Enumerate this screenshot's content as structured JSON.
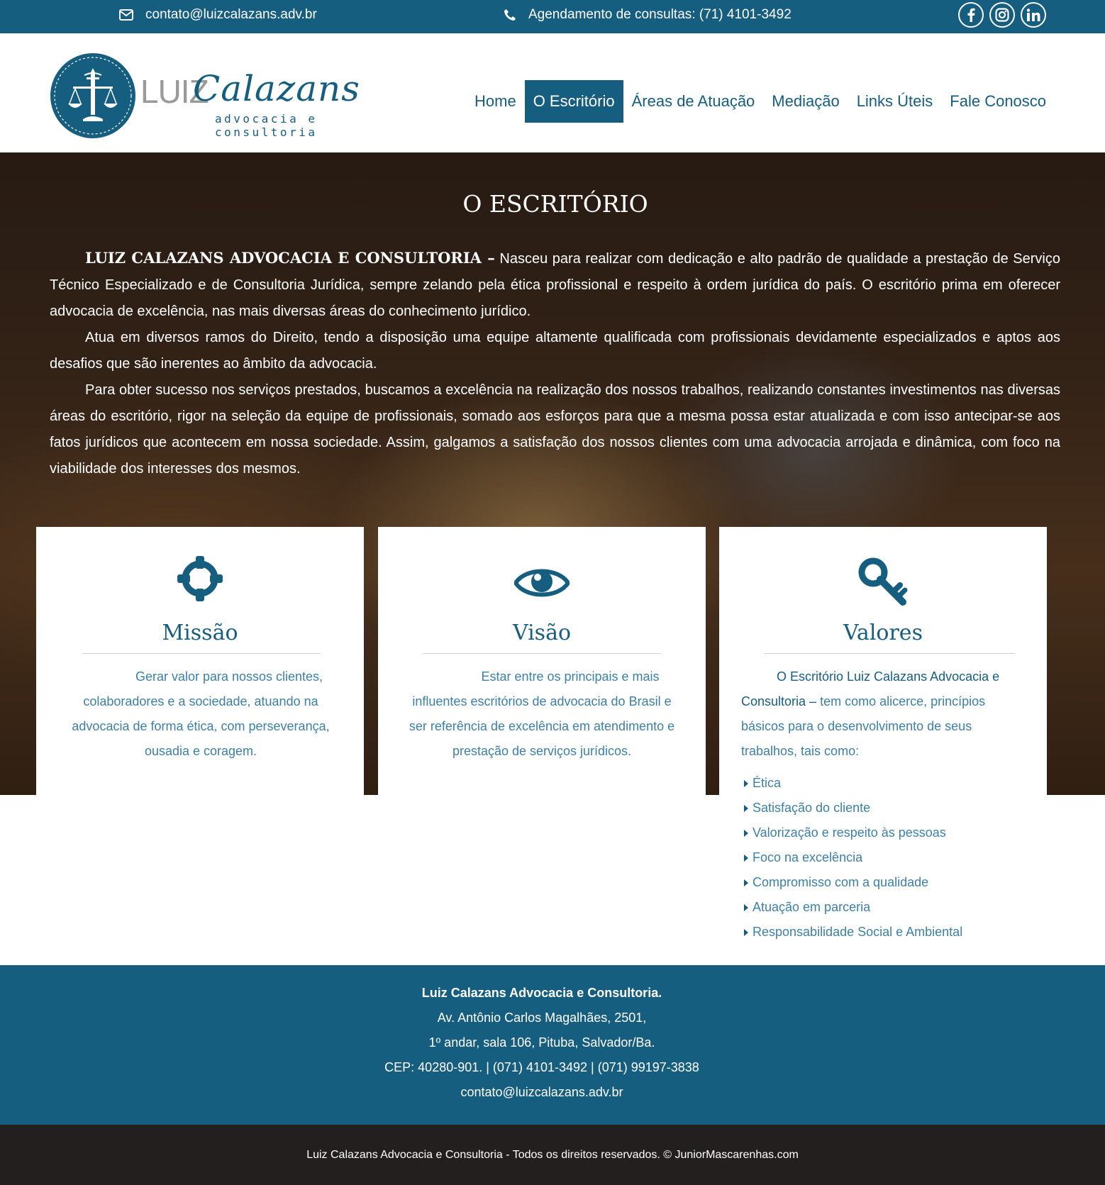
{
  "topbar": {
    "email": "contato@luizcalazans.adv.br",
    "phone": "Agendamento de consultas: (71) 4101-3492",
    "social": [
      "facebook-icon",
      "instagram-icon",
      "linkedin-icon"
    ]
  },
  "logo": {
    "word1": "LUIZ",
    "word2": "Calazans",
    "subtitle": "advocacia e consultoria"
  },
  "nav": {
    "items": [
      {
        "label": "Home"
      },
      {
        "label": "O Escritório",
        "active": true
      },
      {
        "label": "Áreas de Atuação"
      },
      {
        "label": "Mediação"
      },
      {
        "label": "Links Úteis"
      },
      {
        "label": "Fale Conosco"
      }
    ]
  },
  "hero": {
    "title": "O ESCRITÓRIO",
    "p1_strong": "LUIZ CALAZANS ADVOCACIA E CONSULTORIA –",
    "p1": " Nasceu para realizar com dedicação e alto padrão de qualidade a prestação de Serviço Técnico Especializado e de Consultoria Jurídica, sempre zelando pela ética profissional e respeito à ordem jurídica do país. O escritório prima em oferecer advocacia de excelência, nas mais diversas áreas do conhecimento jurídico.",
    "p2": "Atua em diversos ramos do Direito, tendo a disposição uma equipe altamente qualificada com profissionais devidamente especializados e aptos aos desafios que são inerentes ao âmbito da advocacia.",
    "p3": "Para obter sucesso nos serviços prestados, buscamos a excelência na realização dos nossos trabalhos, realizando constantes investimentos nas diversas áreas do escritório, rigor na seleção da equipe de profissionais, somado aos esforços para que a mesma possa estar atualizada e com isso antecipar-se aos fatos jurídicos que acontecem em nossa sociedade. Assim, galgamos a satisfação dos nossos clientes com uma advocacia arrojada e dinâmica, com foco na viabilidade dos interesses dos mesmos."
  },
  "cards": {
    "missao": {
      "icon": "crosshair-icon",
      "title": "Missão",
      "text": "Gerar valor para nossos clientes, colaboradores e a sociedade, atuando na advocacia de forma ética, com perseverança, ousadia e coragem."
    },
    "visao": {
      "icon": "eye-icon",
      "title": "Visão",
      "text": "Estar entre os principais e mais influentes escritórios de advocacia do Brasil e ser referência de excelência em atendimento e prestação de serviços jurídicos."
    },
    "valores": {
      "icon": "key-icon",
      "title": "Valores",
      "text_strong": "O Escritório Luiz Calazans Advocacia e Consultoria –",
      "text": " tem como alicerce, princípios básicos para o desenvolvimento de seus trabalhos, tais como:",
      "items": [
        "Ética",
        "Satisfação do cliente",
        "Valorização e respeito às pessoas",
        "Foco na excelência",
        "Compromisso com a qualidade",
        "Atuação em parceria",
        "Responsabilidade Social e Ambiental"
      ]
    }
  },
  "footer": {
    "company": "Luiz Calazans Advocacia e Consultoria.",
    "address1": "Av. Antônio Carlos Magalhães, 2501,",
    "address2": "1º andar, sala 106, Pituba, Salvador/Ba.",
    "contact": "CEP: 40280-901. | (071) 4101-3492 | (071) 99197-3838",
    "email": "contato@luizcalazans.adv.br",
    "copyright": "Luiz Calazans Advocacia e Consultoria - Todos os direitos reservados. © JuniorMascarenhas.com"
  },
  "colors": {
    "brand": "#165e80",
    "text_blue": "#3d80a6",
    "dark": "#231f1e"
  }
}
